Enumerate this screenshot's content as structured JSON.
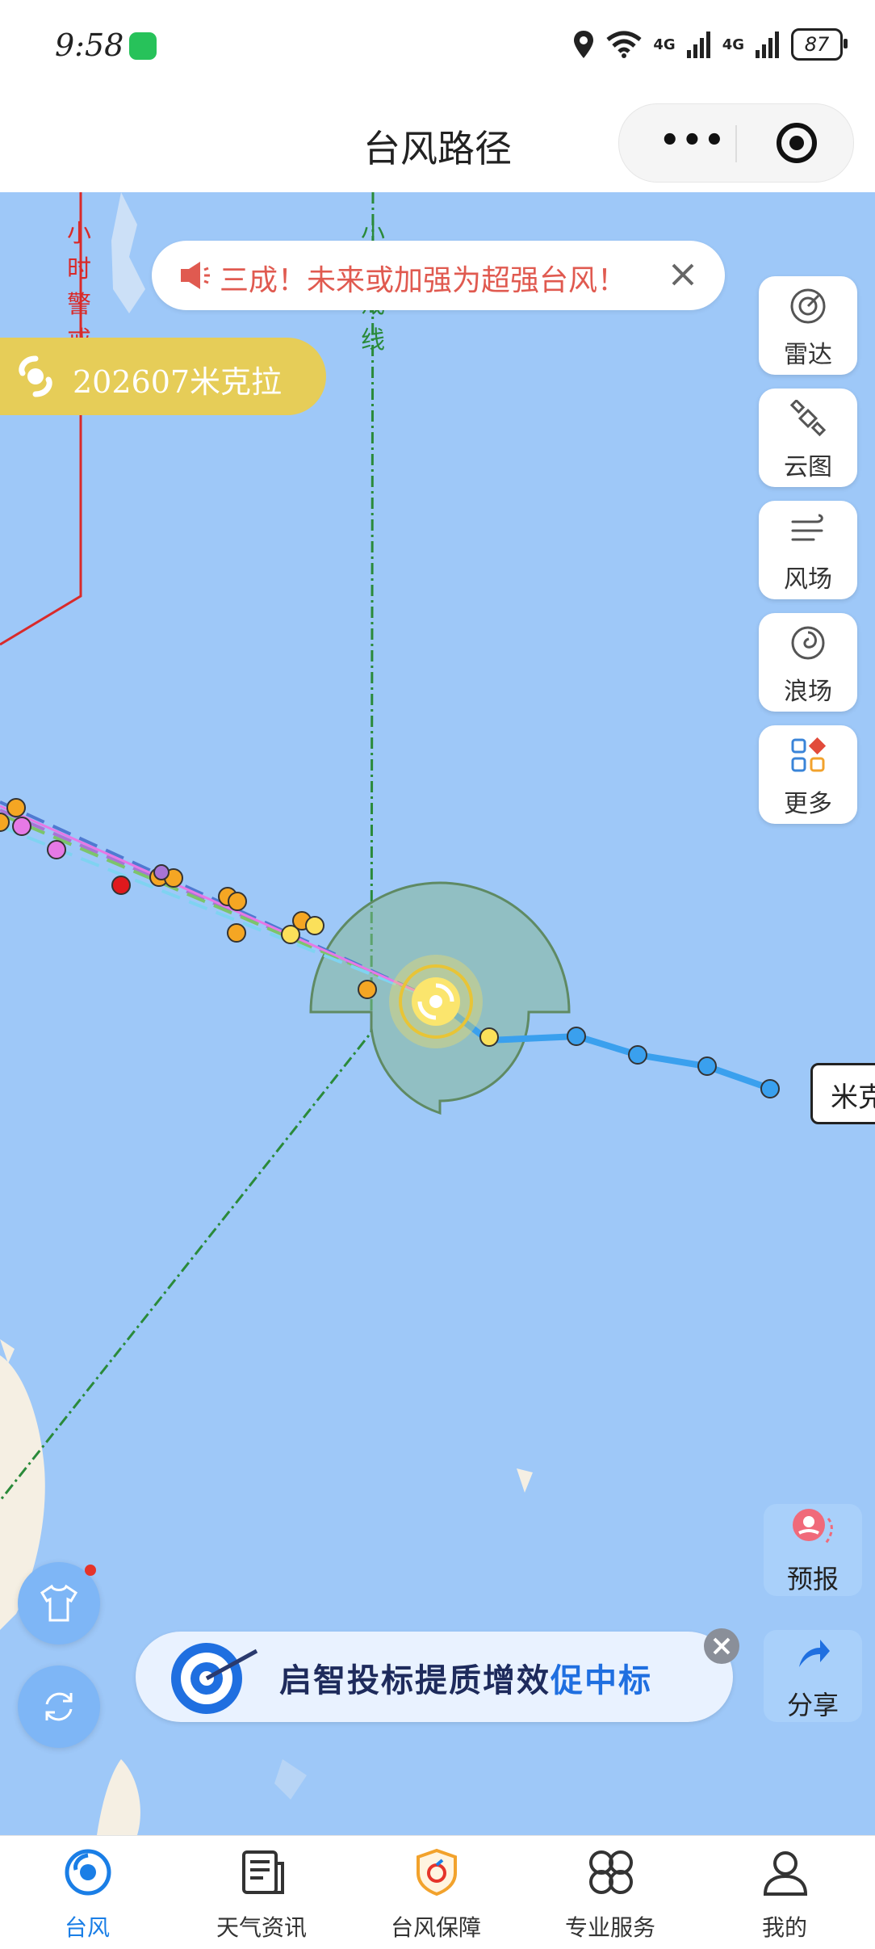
{
  "status_bar": {
    "time": "9:58",
    "battery": "87",
    "network1": "4G",
    "network2": "4G"
  },
  "header": {
    "title": "台风路径"
  },
  "map": {
    "alert_banner": "三成！未来或加强为超强台风！",
    "storm_chip": "202607米克拉",
    "warning_line_24h": "小时警戒线",
    "warning_line_48h": "小警戒线",
    "track_end_label": "米克",
    "tools": [
      "雷达",
      "云图",
      "风场",
      "浪场",
      "更多"
    ],
    "forecast_button": "预报",
    "share_button": "分享",
    "ad_text_main": "启智投标提质增效",
    "ad_text_accent": "促中标"
  },
  "tabs": [
    "台风",
    "天气资讯",
    "台风保障",
    "专业服务",
    "我的"
  ],
  "colors": {
    "sea": "#9ec8f8",
    "track_observed": "#3aa0ee",
    "line_24h": "#d92a2a",
    "line_48h": "#2a8a3a",
    "wind_circle": "#6f9a6a",
    "banner_text": "#e05a50",
    "storm_chip": "#e6cd58",
    "tab_active": "#1a7ee6"
  }
}
